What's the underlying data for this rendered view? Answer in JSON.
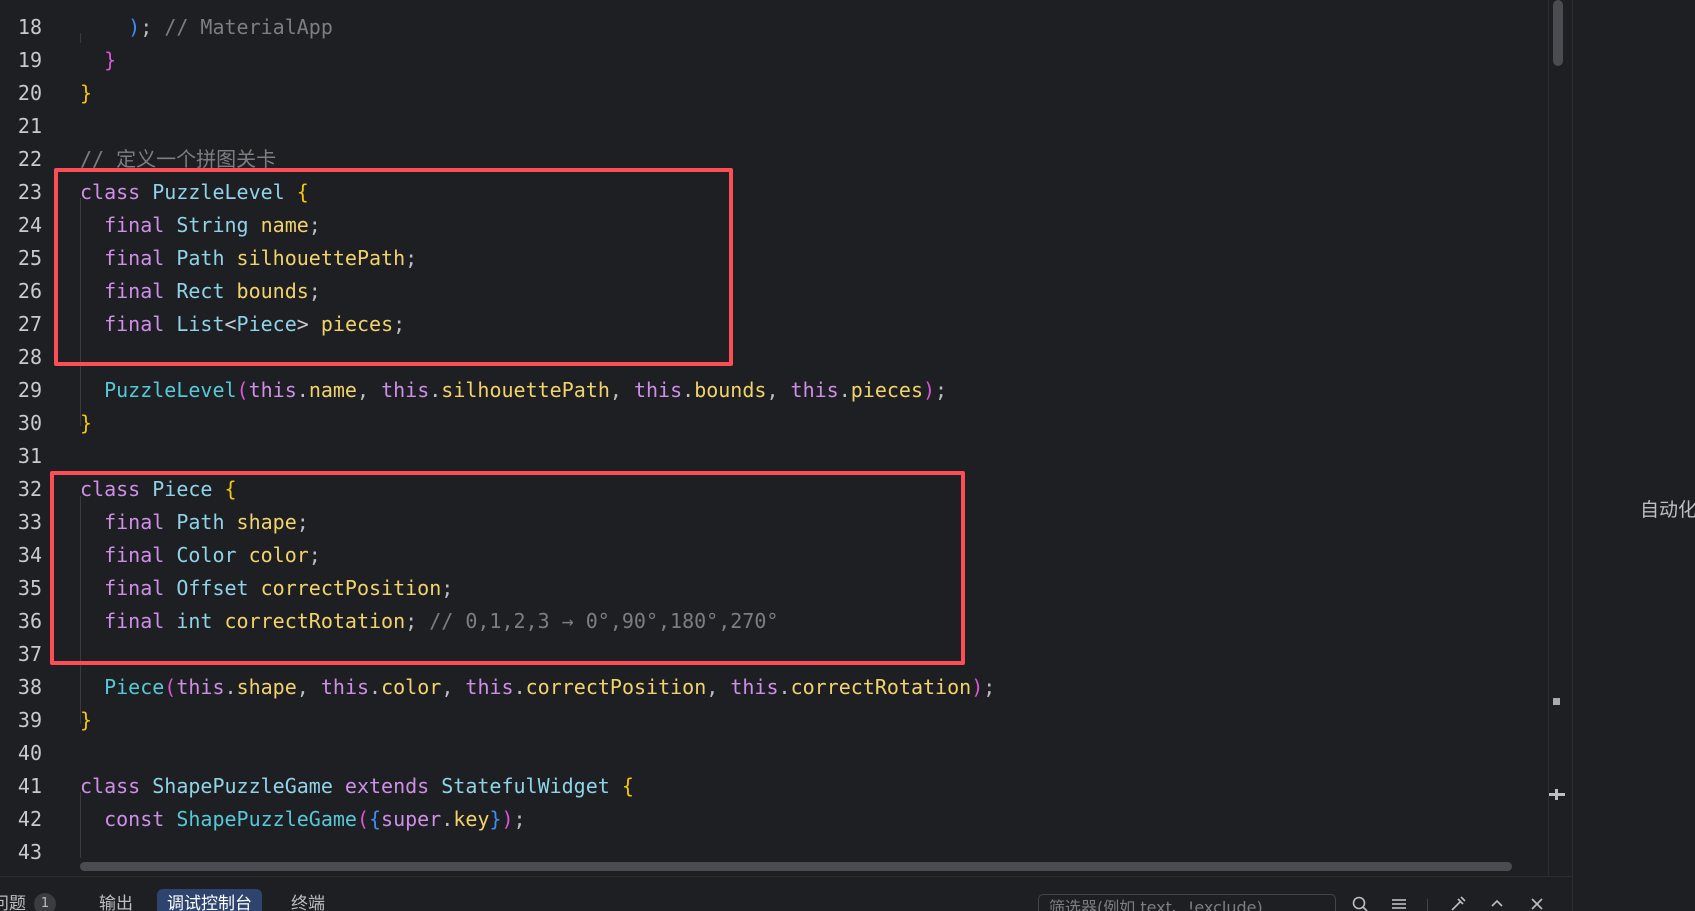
{
  "editor": {
    "lines": [
      {
        "n": "18",
        "code": [
          {
            "t": "    ",
            "c": "tok-punc"
          },
          {
            "t": ")",
            "c": "tok-brace3"
          },
          {
            "t": "; ",
            "c": "tok-punc"
          },
          {
            "t": "// MaterialApp",
            "c": "tok-comment"
          }
        ]
      },
      {
        "n": "19",
        "code": [
          {
            "t": "  ",
            "c": "tok-punc"
          },
          {
            "t": "}",
            "c": "tok-brace2"
          }
        ]
      },
      {
        "n": "20",
        "code": [
          {
            "t": "}",
            "c": "tok-brace1"
          }
        ]
      },
      {
        "n": "21",
        "code": []
      },
      {
        "n": "22",
        "code": [
          {
            "t": "// 定义一个拼图关卡",
            "c": "tok-comment"
          }
        ]
      },
      {
        "n": "23",
        "code": [
          {
            "t": "class ",
            "c": "tok-kw"
          },
          {
            "t": "PuzzleLevel ",
            "c": "tok-cls"
          },
          {
            "t": "{",
            "c": "tok-brace1"
          }
        ]
      },
      {
        "n": "24",
        "code": [
          {
            "t": "  final ",
            "c": "tok-kw"
          },
          {
            "t": "String ",
            "c": "tok-cls"
          },
          {
            "t": "name",
            "c": "tok-field"
          },
          {
            "t": ";",
            "c": "tok-punc"
          }
        ]
      },
      {
        "n": "25",
        "code": [
          {
            "t": "  final ",
            "c": "tok-kw"
          },
          {
            "t": "Path ",
            "c": "tok-cls"
          },
          {
            "t": "silhouettePath",
            "c": "tok-field"
          },
          {
            "t": ";",
            "c": "tok-punc"
          }
        ]
      },
      {
        "n": "26",
        "code": [
          {
            "t": "  final ",
            "c": "tok-kw"
          },
          {
            "t": "Rect ",
            "c": "tok-cls"
          },
          {
            "t": "bounds",
            "c": "tok-field"
          },
          {
            "t": ";",
            "c": "tok-punc"
          }
        ]
      },
      {
        "n": "27",
        "code": [
          {
            "t": "  final ",
            "c": "tok-kw"
          },
          {
            "t": "List",
            "c": "tok-cls"
          },
          {
            "t": "<",
            "c": "tok-gen"
          },
          {
            "t": "Piece",
            "c": "tok-cls"
          },
          {
            "t": "> ",
            "c": "tok-gen"
          },
          {
            "t": "pieces",
            "c": "tok-field"
          },
          {
            "t": ";",
            "c": "tok-punc"
          }
        ]
      },
      {
        "n": "28",
        "code": []
      },
      {
        "n": "29",
        "code": [
          {
            "t": "  PuzzleLevel",
            "c": "tok-fn"
          },
          {
            "t": "(",
            "c": "tok-brace2"
          },
          {
            "t": "this",
            "c": "tok-this"
          },
          {
            "t": ".",
            "c": "tok-punc"
          },
          {
            "t": "name",
            "c": "tok-field"
          },
          {
            "t": ", ",
            "c": "tok-punc"
          },
          {
            "t": "this",
            "c": "tok-this"
          },
          {
            "t": ".",
            "c": "tok-punc"
          },
          {
            "t": "silhouettePath",
            "c": "tok-field"
          },
          {
            "t": ", ",
            "c": "tok-punc"
          },
          {
            "t": "this",
            "c": "tok-this"
          },
          {
            "t": ".",
            "c": "tok-punc"
          },
          {
            "t": "bounds",
            "c": "tok-field"
          },
          {
            "t": ", ",
            "c": "tok-punc"
          },
          {
            "t": "this",
            "c": "tok-this"
          },
          {
            "t": ".",
            "c": "tok-punc"
          },
          {
            "t": "pieces",
            "c": "tok-field"
          },
          {
            "t": ")",
            "c": "tok-brace2"
          },
          {
            "t": ";",
            "c": "tok-punc"
          }
        ]
      },
      {
        "n": "30",
        "code": [
          {
            "t": "}",
            "c": "tok-brace1"
          }
        ]
      },
      {
        "n": "31",
        "code": []
      },
      {
        "n": "32",
        "code": [
          {
            "t": "class ",
            "c": "tok-kw"
          },
          {
            "t": "Piece ",
            "c": "tok-cls"
          },
          {
            "t": "{",
            "c": "tok-brace1"
          }
        ]
      },
      {
        "n": "33",
        "code": [
          {
            "t": "  final ",
            "c": "tok-kw"
          },
          {
            "t": "Path ",
            "c": "tok-cls"
          },
          {
            "t": "shape",
            "c": "tok-field"
          },
          {
            "t": ";",
            "c": "tok-punc"
          }
        ]
      },
      {
        "n": "34",
        "code": [
          {
            "t": "  final ",
            "c": "tok-kw"
          },
          {
            "t": "Color ",
            "c": "tok-cls"
          },
          {
            "t": "color",
            "c": "tok-field"
          },
          {
            "t": ";",
            "c": "tok-punc"
          }
        ]
      },
      {
        "n": "35",
        "code": [
          {
            "t": "  final ",
            "c": "tok-kw"
          },
          {
            "t": "Offset ",
            "c": "tok-cls"
          },
          {
            "t": "correctPosition",
            "c": "tok-field"
          },
          {
            "t": ";",
            "c": "tok-punc"
          }
        ]
      },
      {
        "n": "36",
        "code": [
          {
            "t": "  final ",
            "c": "tok-kw"
          },
          {
            "t": "int ",
            "c": "tok-cls"
          },
          {
            "t": "correctRotation",
            "c": "tok-field"
          },
          {
            "t": "; ",
            "c": "tok-punc"
          },
          {
            "t": "// 0,1,2,3 → 0°,90°,180°,270°",
            "c": "tok-comment"
          }
        ]
      },
      {
        "n": "37",
        "code": []
      },
      {
        "n": "38",
        "code": [
          {
            "t": "  Piece",
            "c": "tok-fn"
          },
          {
            "t": "(",
            "c": "tok-brace2"
          },
          {
            "t": "this",
            "c": "tok-this"
          },
          {
            "t": ".",
            "c": "tok-punc"
          },
          {
            "t": "shape",
            "c": "tok-field"
          },
          {
            "t": ", ",
            "c": "tok-punc"
          },
          {
            "t": "this",
            "c": "tok-this"
          },
          {
            "t": ".",
            "c": "tok-punc"
          },
          {
            "t": "color",
            "c": "tok-field"
          },
          {
            "t": ", ",
            "c": "tok-punc"
          },
          {
            "t": "this",
            "c": "tok-this"
          },
          {
            "t": ".",
            "c": "tok-punc"
          },
          {
            "t": "correctPosition",
            "c": "tok-field"
          },
          {
            "t": ", ",
            "c": "tok-punc"
          },
          {
            "t": "this",
            "c": "tok-this"
          },
          {
            "t": ".",
            "c": "tok-punc"
          },
          {
            "t": "correctRotation",
            "c": "tok-field"
          },
          {
            "t": ")",
            "c": "tok-brace2"
          },
          {
            "t": ";",
            "c": "tok-punc"
          }
        ]
      },
      {
        "n": "39",
        "code": [
          {
            "t": "}",
            "c": "tok-brace1"
          }
        ]
      },
      {
        "n": "40",
        "code": []
      },
      {
        "n": "41",
        "code": [
          {
            "t": "class ",
            "c": "tok-kw"
          },
          {
            "t": "ShapePuzzleGame ",
            "c": "tok-cls"
          },
          {
            "t": "extends ",
            "c": "tok-kw"
          },
          {
            "t": "StatefulWidget ",
            "c": "tok-cls"
          },
          {
            "t": "{",
            "c": "tok-brace1"
          }
        ]
      },
      {
        "n": "42",
        "code": [
          {
            "t": "  const ",
            "c": "tok-kw"
          },
          {
            "t": "ShapePuzzleGame",
            "c": "tok-fn"
          },
          {
            "t": "(",
            "c": "tok-brace2"
          },
          {
            "t": "{",
            "c": "tok-brace3"
          },
          {
            "t": "super",
            "c": "tok-kw"
          },
          {
            "t": ".",
            "c": "tok-punc"
          },
          {
            "t": "key",
            "c": "tok-field"
          },
          {
            "t": "}",
            "c": "tok-brace3"
          },
          {
            "t": ")",
            "c": "tok-brace2"
          },
          {
            "t": ";",
            "c": "tok-punc"
          }
        ]
      },
      {
        "n": "43",
        "code": []
      }
    ]
  },
  "right_panel": {
    "label": "自动化"
  },
  "bottom_bar": {
    "tabs": [
      {
        "label": "问题",
        "badge": "1"
      },
      {
        "label": "输出"
      },
      {
        "label": "调试控制台"
      },
      {
        "label": "终端"
      }
    ],
    "filter_placeholder": "筛选器(例如 text、!exclude)"
  },
  "colors": {
    "background": "#1e1f22",
    "highlight": "#ff4d55",
    "keyword": "#cf8ee8",
    "type": "#8fd3e8",
    "field": "#f2d36b",
    "comment": "#7a7e85"
  }
}
